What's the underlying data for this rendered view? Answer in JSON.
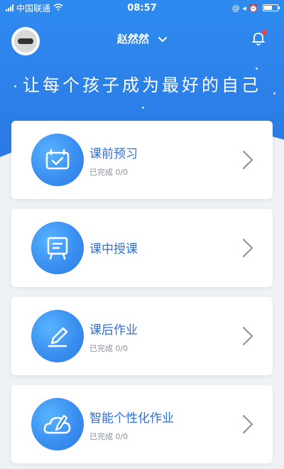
{
  "status_bar": {
    "carrier": "中国联通",
    "time": "08:57",
    "indicators": "@ ◂ ⏰"
  },
  "header": {
    "user_name": "赵然然",
    "avatar_icon": "avatar-icon",
    "bell_icon": "bell-icon"
  },
  "slogan": "让每个孩子成为最好的自己",
  "cards": [
    {
      "title": "课前预习",
      "subtitle": "已完成 0/0",
      "icon": "checklist-icon"
    },
    {
      "title": "课中授课",
      "subtitle": "",
      "icon": "blackboard-icon"
    },
    {
      "title": "课后作业",
      "subtitle": "已完成 0/0",
      "icon": "pencil-icon"
    },
    {
      "title": "智能个性化作业",
      "subtitle": "已完成 0/0",
      "icon": "cloud-pencil-icon"
    }
  ],
  "colors": {
    "primary": "#2f8bf0",
    "title_blue": "#2f6fd6",
    "background": "#eef1f5",
    "notification_dot": "#ff3b3b"
  }
}
